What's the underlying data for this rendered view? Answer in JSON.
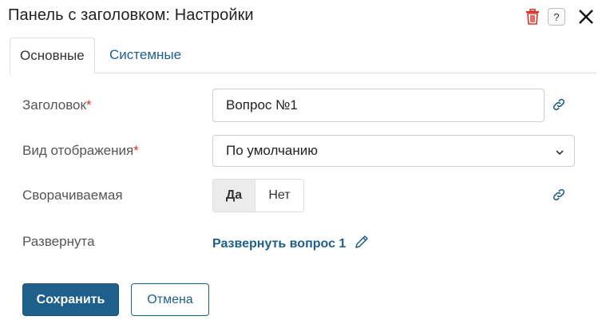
{
  "dialog": {
    "title": "Панель с заголовком: Настройки",
    "actions": {
      "delete_icon": "trash-icon",
      "help_label": "?",
      "close_icon": "close-icon"
    }
  },
  "tabs": [
    {
      "label": "Основные",
      "active": true
    },
    {
      "label": "Системные",
      "active": false
    }
  ],
  "form": {
    "title_field": {
      "label": "Заголовок",
      "required_mark": "*",
      "value": "Вопрос №1"
    },
    "display_field": {
      "label": "Вид отображения",
      "required_mark": "*",
      "value": "По умолчанию"
    },
    "collapsible_field": {
      "label": "Сворачиваемая",
      "options": [
        "Да",
        "Нет"
      ],
      "selected": "Да"
    },
    "expanded_field": {
      "label": "Развернута",
      "link_text": "Развернуть вопрос 1"
    }
  },
  "buttons": {
    "save": "Сохранить",
    "cancel": "Отмена"
  },
  "colors": {
    "accent": "#1f5f8b",
    "required": "#d6322b",
    "delete": "#d6322b"
  }
}
